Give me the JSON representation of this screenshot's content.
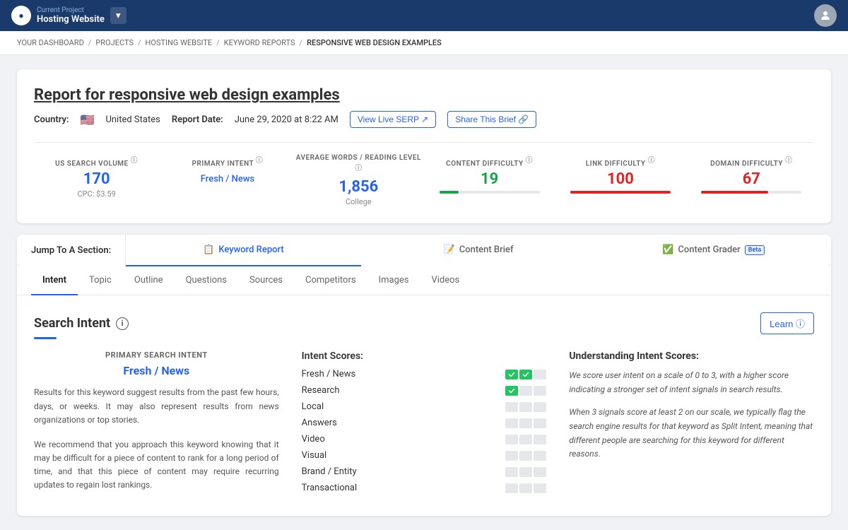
{
  "topNav": {
    "currentProjectLabel": "Current Project",
    "projectName": "Hosting Website",
    "dropdownArrow": "▾",
    "userInitial": "👤"
  },
  "breadcrumb": {
    "items": [
      "YOUR DASHBOARD",
      "PROJECTS",
      "HOSTING WEBSITE",
      "KEYWORD REPORTS",
      "RESPONSIVE WEB DESIGN EXAMPLES"
    ]
  },
  "report": {
    "titlePrefix": "Report for ",
    "titleKeyword": "responsive web design examples",
    "countryLabel": "Country:",
    "countryFlag": "🇺🇸",
    "countryName": "United States",
    "reportDateLabel": "Report Date:",
    "reportDate": "June 29, 2020 at 8:22 AM",
    "viewLiveSerpBtn": "View Live SERP ↗",
    "shareThisBriefBtn": "Share This Brief 🔗"
  },
  "stats": {
    "searchVolume": {
      "label": "US SEARCH VOLUME",
      "info": "ⓘ",
      "value": "170",
      "sub": "CPC: $3.59"
    },
    "primaryIntent": {
      "label": "PRIMARY INTENT",
      "info": "ⓘ",
      "value": "Fresh / News"
    },
    "avgWords": {
      "label": "AVERAGE WORDS / READING LEVEL",
      "info": "ⓘ",
      "value": "1,856",
      "sub": "College"
    },
    "contentDifficulty": {
      "label": "CONTENT DIFFICULTY",
      "info": "ⓘ",
      "value": "19",
      "progressColor": "green",
      "progressWidth": "19%"
    },
    "linkDifficulty": {
      "label": "LINK DIFFICULTY",
      "info": "ⓘ",
      "value": "100",
      "progressColor": "red",
      "progressWidth": "100%"
    },
    "domainDifficulty": {
      "label": "DOMAIN DIFFICULTY",
      "info": "ⓘ",
      "value": "67",
      "progressColor": "red",
      "progressWidth": "67%"
    }
  },
  "sectionNav": {
    "jumpLabel": "Jump To A Section:",
    "tabs": [
      {
        "id": "keyword-report",
        "icon": "📋",
        "label": "Keyword Report",
        "active": true
      },
      {
        "id": "content-brief",
        "icon": "📝",
        "label": "Content Brief",
        "active": false
      },
      {
        "id": "content-grader",
        "icon": "✅",
        "label": "Content Grader",
        "active": false,
        "beta": true
      }
    ]
  },
  "subTabs": {
    "tabs": [
      {
        "id": "intent",
        "label": "Intent",
        "active": true
      },
      {
        "id": "topic",
        "label": "Topic",
        "active": false
      },
      {
        "id": "outline",
        "label": "Outline",
        "active": false
      },
      {
        "id": "questions",
        "label": "Questions",
        "active": false
      },
      {
        "id": "sources",
        "label": "Sources",
        "active": false
      },
      {
        "id": "competitors",
        "label": "Competitors",
        "active": false
      },
      {
        "id": "images",
        "label": "Images",
        "active": false
      },
      {
        "id": "videos",
        "label": "Videos",
        "active": false
      }
    ]
  },
  "searchIntent": {
    "title": "Search Intent",
    "learnBtn": "Learn ⓘ",
    "primaryIntentLabel": "PRIMARY SEARCH INTENT",
    "primaryIntentValue": "Fresh / News",
    "descriptionParagraph1": "Results for this keyword suggest results from the past few hours, days, or weeks. It may also represent results from news organizations or top stories.",
    "descriptionParagraph2": "We recommend that you approach this keyword knowing that it may be difficult for a piece of content to rank for a long period of time, and that this piece of content may require recurring updates to regain lost rankings.",
    "intentScoresTitle": "Intent Scores:",
    "intentScores": [
      {
        "name": "Fresh / News",
        "filled": 2,
        "empty": 1
      },
      {
        "name": "Research",
        "filled": 1,
        "empty": 2
      },
      {
        "name": "Local",
        "filled": 0,
        "empty": 3
      },
      {
        "name": "Answers",
        "filled": 0,
        "empty": 3
      },
      {
        "name": "Video",
        "filled": 0,
        "empty": 3
      },
      {
        "name": "Visual",
        "filled": 0,
        "empty": 3
      },
      {
        "name": "Brand / Entity",
        "filled": 0,
        "empty": 3
      },
      {
        "name": "Transactional",
        "filled": 0,
        "empty": 3
      }
    ],
    "understandingTitle": "Understanding Intent Scores:",
    "understandingText1": "We score user intent on a scale of 0 to 3, with a higher score indicating a stronger set of intent signals in search results.",
    "understandingText2": "When 3 signals score at least 2 on our scale, we typically flag the search engine results for that keyword as Split Intent, meaning that different people are searching for this keyword for different reasons."
  }
}
